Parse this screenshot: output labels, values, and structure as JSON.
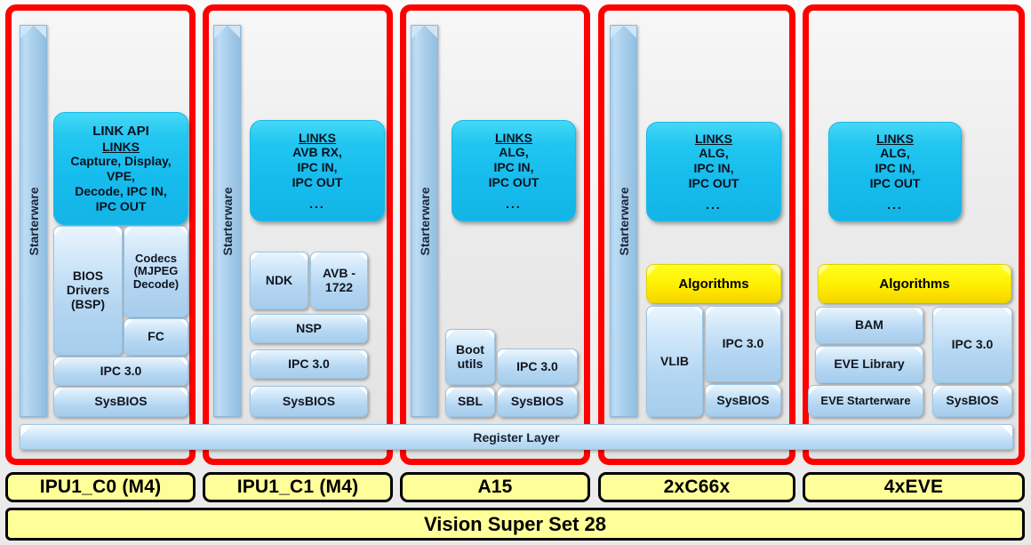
{
  "diagram": {
    "title": "Vision Super Set 28",
    "register_layer_label": "Register Layer",
    "starterware_label": "Starterware",
    "colors": {
      "core_frame": "#ff0000",
      "links_box": "#16bced",
      "algorithms_box": "#ffee00",
      "component_box": "#b4d6f2",
      "label_box": "#ffff99"
    }
  },
  "cores": [
    {
      "id": "ipu1_c0",
      "label": "IPU1_C0 (M4)",
      "starterware": "Starterware",
      "links": {
        "title": "LINK API",
        "heading": "LINKS",
        "items": "Capture, Display,\nVPE,\nDecode,  IPC IN,\nIPC OUT",
        "ellipsis": ""
      },
      "components": [
        {
          "name": "BIOS Drivers (BSP)"
        },
        {
          "name": "Codecs (MJPEG Decode)"
        },
        {
          "name": "FC"
        },
        {
          "name": "IPC 3.0"
        },
        {
          "name": "SysBIOS"
        }
      ]
    },
    {
      "id": "ipu1_c1",
      "label": "IPU1_C1 (M4)",
      "starterware": "Starterware",
      "links": {
        "title": "",
        "heading": "LINKS",
        "items": "AVB RX,\nIPC IN,\nIPC OUT",
        "ellipsis": "..."
      },
      "components": [
        {
          "name": "NDK"
        },
        {
          "name": "AVB - 1722"
        },
        {
          "name": "NSP"
        },
        {
          "name": "IPC 3.0"
        },
        {
          "name": "SysBIOS"
        }
      ]
    },
    {
      "id": "a15",
      "label": "A15",
      "starterware": "Starterware",
      "links": {
        "title": "",
        "heading": "LINKS",
        "items": "ALG,\nIPC IN,\nIPC OUT",
        "ellipsis": "..."
      },
      "components": [
        {
          "name": "Boot utils"
        },
        {
          "name": "IPC 3.0"
        },
        {
          "name": "SBL"
        },
        {
          "name": "SysBIOS"
        }
      ]
    },
    {
      "id": "c66x",
      "label": "2xC66x",
      "starterware": "Starterware",
      "links": {
        "title": "",
        "heading": "LINKS",
        "items": "ALG,\nIPC IN,\nIPC OUT",
        "ellipsis": "..."
      },
      "algorithms": "Algorithms",
      "components": [
        {
          "name": "VLIB"
        },
        {
          "name": "IPC 3.0"
        },
        {
          "name": "SysBIOS"
        }
      ]
    },
    {
      "id": "eve",
      "label": "4xEVE",
      "starterware": "",
      "links": {
        "title": "",
        "heading": "LINKS",
        "items": "ALG,\nIPC IN,\nIPC OUT",
        "ellipsis": "..."
      },
      "algorithms": "Algorithms",
      "components": [
        {
          "name": "BAM"
        },
        {
          "name": "EVE Library"
        },
        {
          "name": "IPC 3.0"
        },
        {
          "name": "EVE Starterware"
        },
        {
          "name": "SysBIOS"
        }
      ]
    }
  ]
}
